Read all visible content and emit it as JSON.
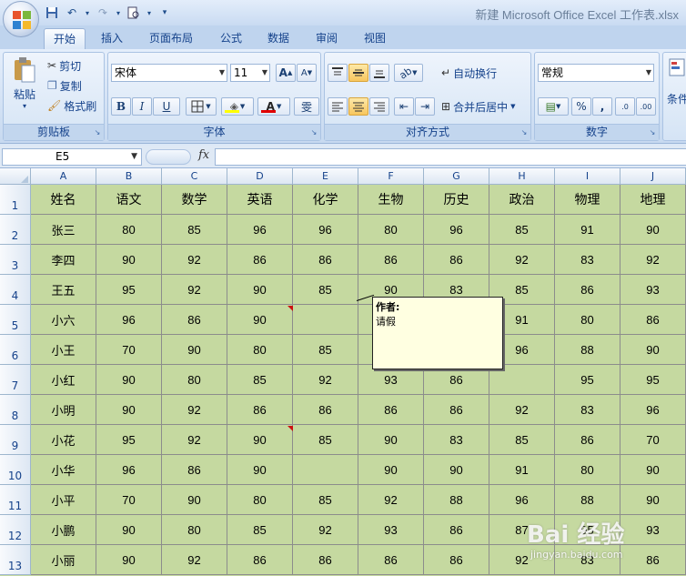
{
  "window": {
    "title": "新建 Microsoft Office Excel 工作表.xlsx",
    "qat_icons": [
      "save-icon",
      "undo-icon",
      "redo-icon",
      "print-preview-icon",
      "customize-qat-icon"
    ]
  },
  "tabs": [
    "开始",
    "插入",
    "页面布局",
    "公式",
    "数据",
    "审阅",
    "视图"
  ],
  "active_tab": "开始",
  "ribbon": {
    "clipboard": {
      "paste": "粘贴",
      "cut": "剪切",
      "copy": "复制",
      "format_painter": "格式刷",
      "label": "剪贴板"
    },
    "font": {
      "font_name": "宋体",
      "font_size": "11",
      "bold": "B",
      "italic": "I",
      "underline": "U",
      "fill_glyph": "◈",
      "font_color_glyph": "A",
      "phonetic": "雯",
      "label": "字体",
      "grow": "A",
      "shrink": "A"
    },
    "alignment": {
      "wrap_text": "自动换行",
      "merge_center": "合并后居中",
      "label": "对齐方式"
    },
    "number": {
      "format": "常规",
      "percent": "%",
      "comma": ",",
      "inc_decimal": ".0",
      "dec_decimal": ".00",
      "label": "数字",
      "conditional": "条件"
    }
  },
  "formula_bar": {
    "name_box": "E5",
    "fx": "fx",
    "formula": ""
  },
  "columns": [
    "A",
    "B",
    "C",
    "D",
    "E",
    "F",
    "G",
    "H",
    "I",
    "J"
  ],
  "row_numbers": [
    "1",
    "2",
    "3",
    "4",
    "5",
    "6",
    "7",
    "8",
    "9",
    "10",
    "11",
    "12",
    "13"
  ],
  "table": [
    [
      "姓名",
      "语文",
      "数学",
      "英语",
      "化学",
      "生物",
      "历史",
      "政治",
      "物理",
      "地理"
    ],
    [
      "张三",
      "80",
      "85",
      "96",
      "96",
      "80",
      "96",
      "85",
      "91",
      "90"
    ],
    [
      "李四",
      "90",
      "92",
      "86",
      "86",
      "86",
      "86",
      "92",
      "83",
      "92"
    ],
    [
      "王五",
      "95",
      "92",
      "90",
      "85",
      "90",
      "83",
      "85",
      "86",
      "93"
    ],
    [
      "小六",
      "96",
      "86",
      "90",
      "",
      "",
      "",
      "91",
      "80",
      "86"
    ],
    [
      "小王",
      "70",
      "90",
      "80",
      "85",
      "",
      "",
      "96",
      "88",
      "90"
    ],
    [
      "小红",
      "90",
      "80",
      "85",
      "92",
      "93",
      "86",
      "",
      "95",
      "95"
    ],
    [
      "小明",
      "90",
      "92",
      "86",
      "86",
      "86",
      "86",
      "92",
      "83",
      "96"
    ],
    [
      "小花",
      "95",
      "92",
      "90",
      "85",
      "90",
      "83",
      "85",
      "86",
      "70"
    ],
    [
      "小华",
      "96",
      "86",
      "90",
      "",
      "90",
      "90",
      "91",
      "80",
      "90"
    ],
    [
      "小平",
      "70",
      "90",
      "80",
      "85",
      "92",
      "88",
      "96",
      "88",
      "90"
    ],
    [
      "小鹏",
      "90",
      "80",
      "85",
      "92",
      "93",
      "86",
      "87",
      "95",
      "93"
    ],
    [
      "小丽",
      "90",
      "92",
      "86",
      "86",
      "86",
      "86",
      "92",
      "83",
      "86"
    ]
  ],
  "comment": {
    "author": "作者:",
    "text": "请假"
  },
  "watermark": {
    "brand": "Bai 经验",
    "url": "jingyan.baidu.com"
  },
  "colors": {
    "cell_fill": "#c5d9a0",
    "comment_bg": "#ffffe1",
    "accent": "#15428b"
  }
}
